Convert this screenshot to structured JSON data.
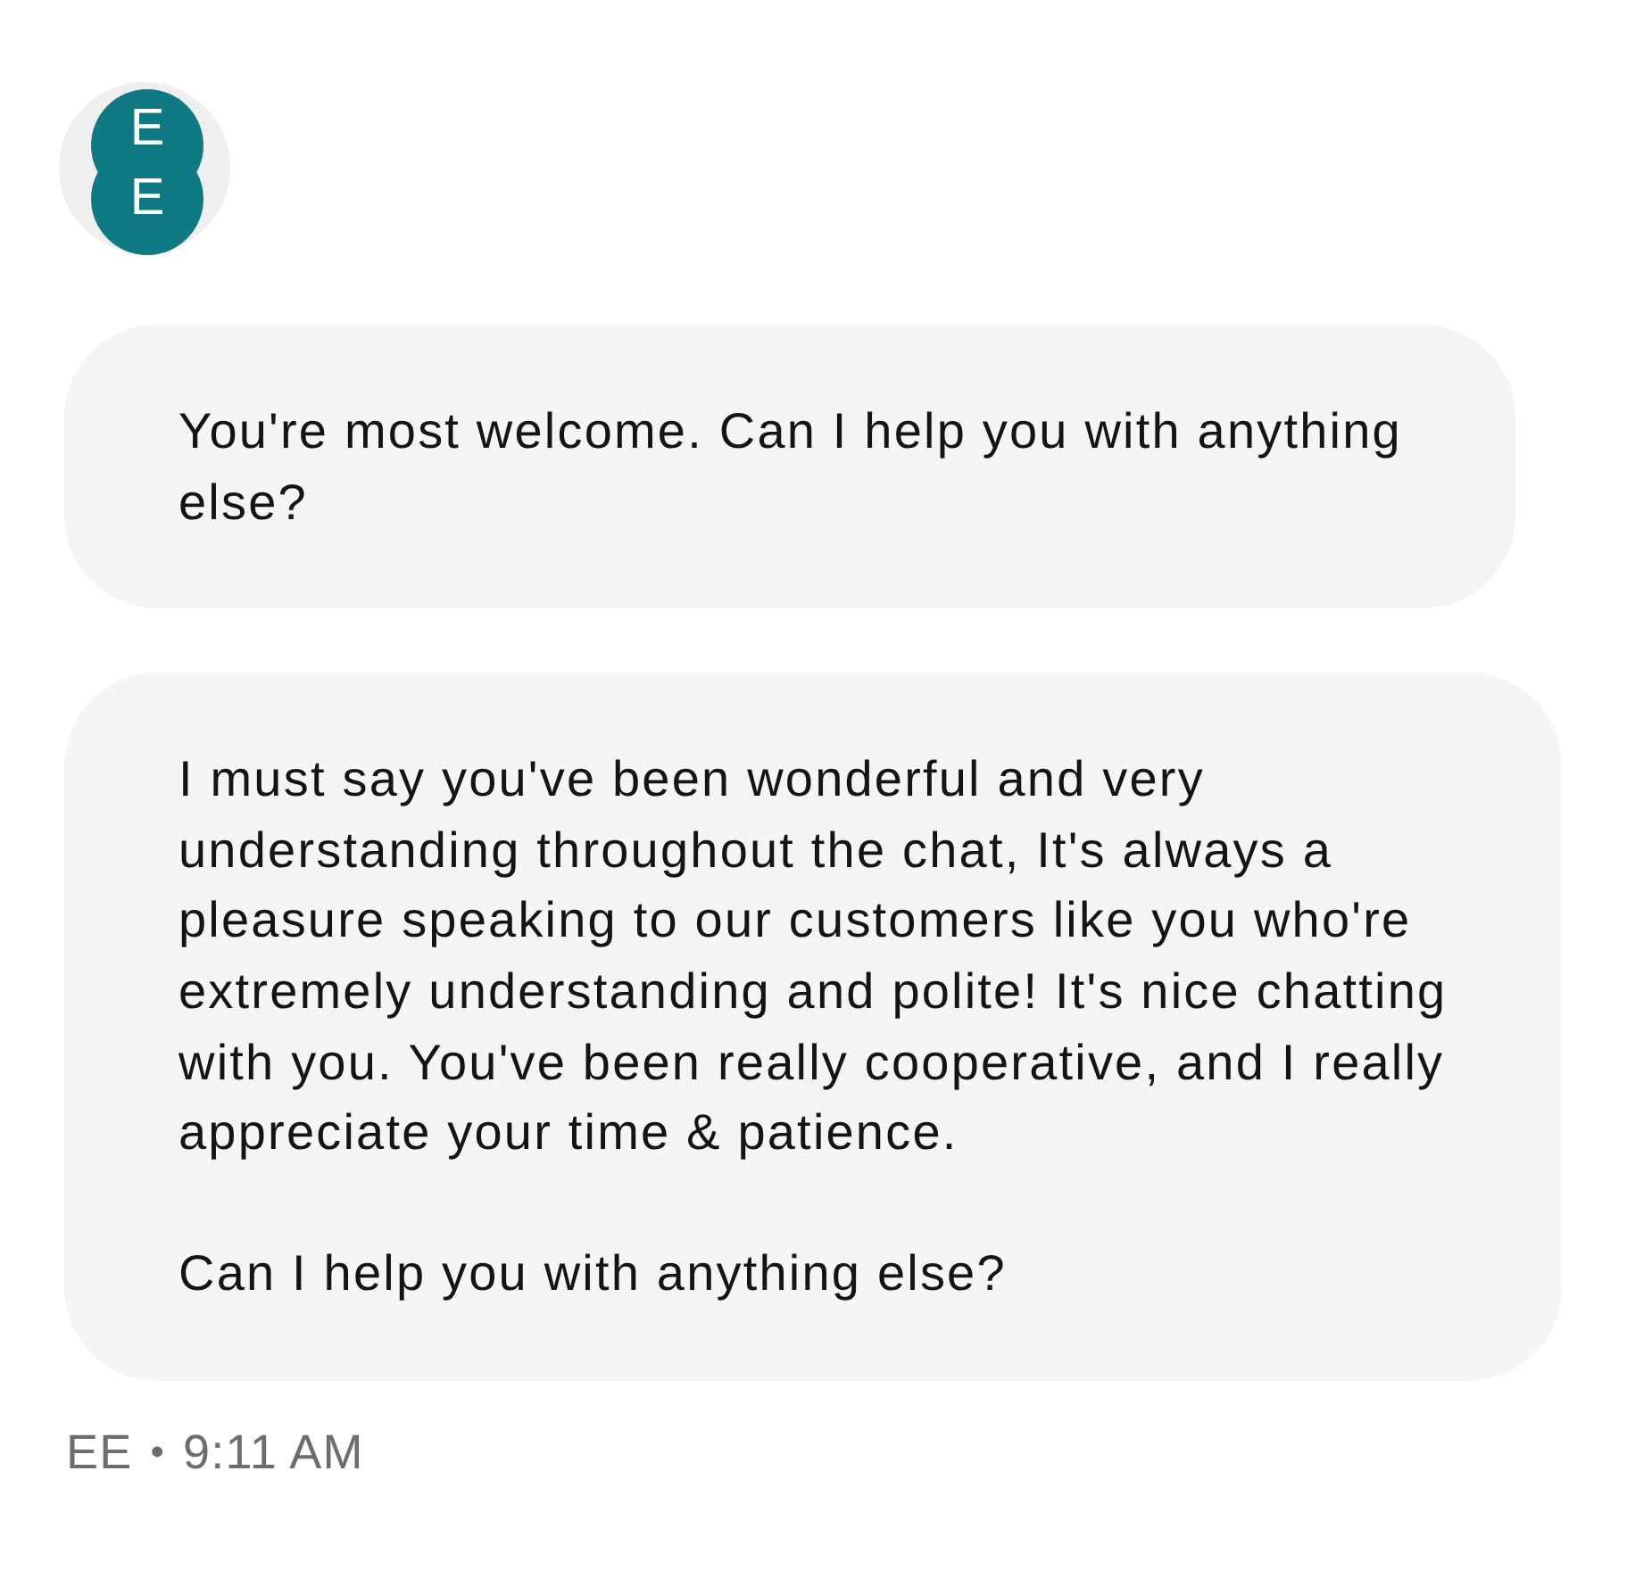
{
  "avatar": {
    "logo_letters": [
      "E",
      "E"
    ]
  },
  "messages": [
    {
      "paragraphs": [
        "You're most welcome. Can I help you with anything\nelse?"
      ]
    },
    {
      "paragraphs": [
        "I must say you've been wonderful and very\nunderstanding throughout the chat, It's always a\npleasure speaking to our customers like you who're\nextremely understanding and polite! It's nice chatting\nwith you. You've been really cooperative, and I really\nappreciate your time & patience.",
        "Can I help you with anything else?"
      ]
    }
  ],
  "meta": {
    "sender": "EE",
    "separator": "•",
    "time": "9:11 AM"
  }
}
